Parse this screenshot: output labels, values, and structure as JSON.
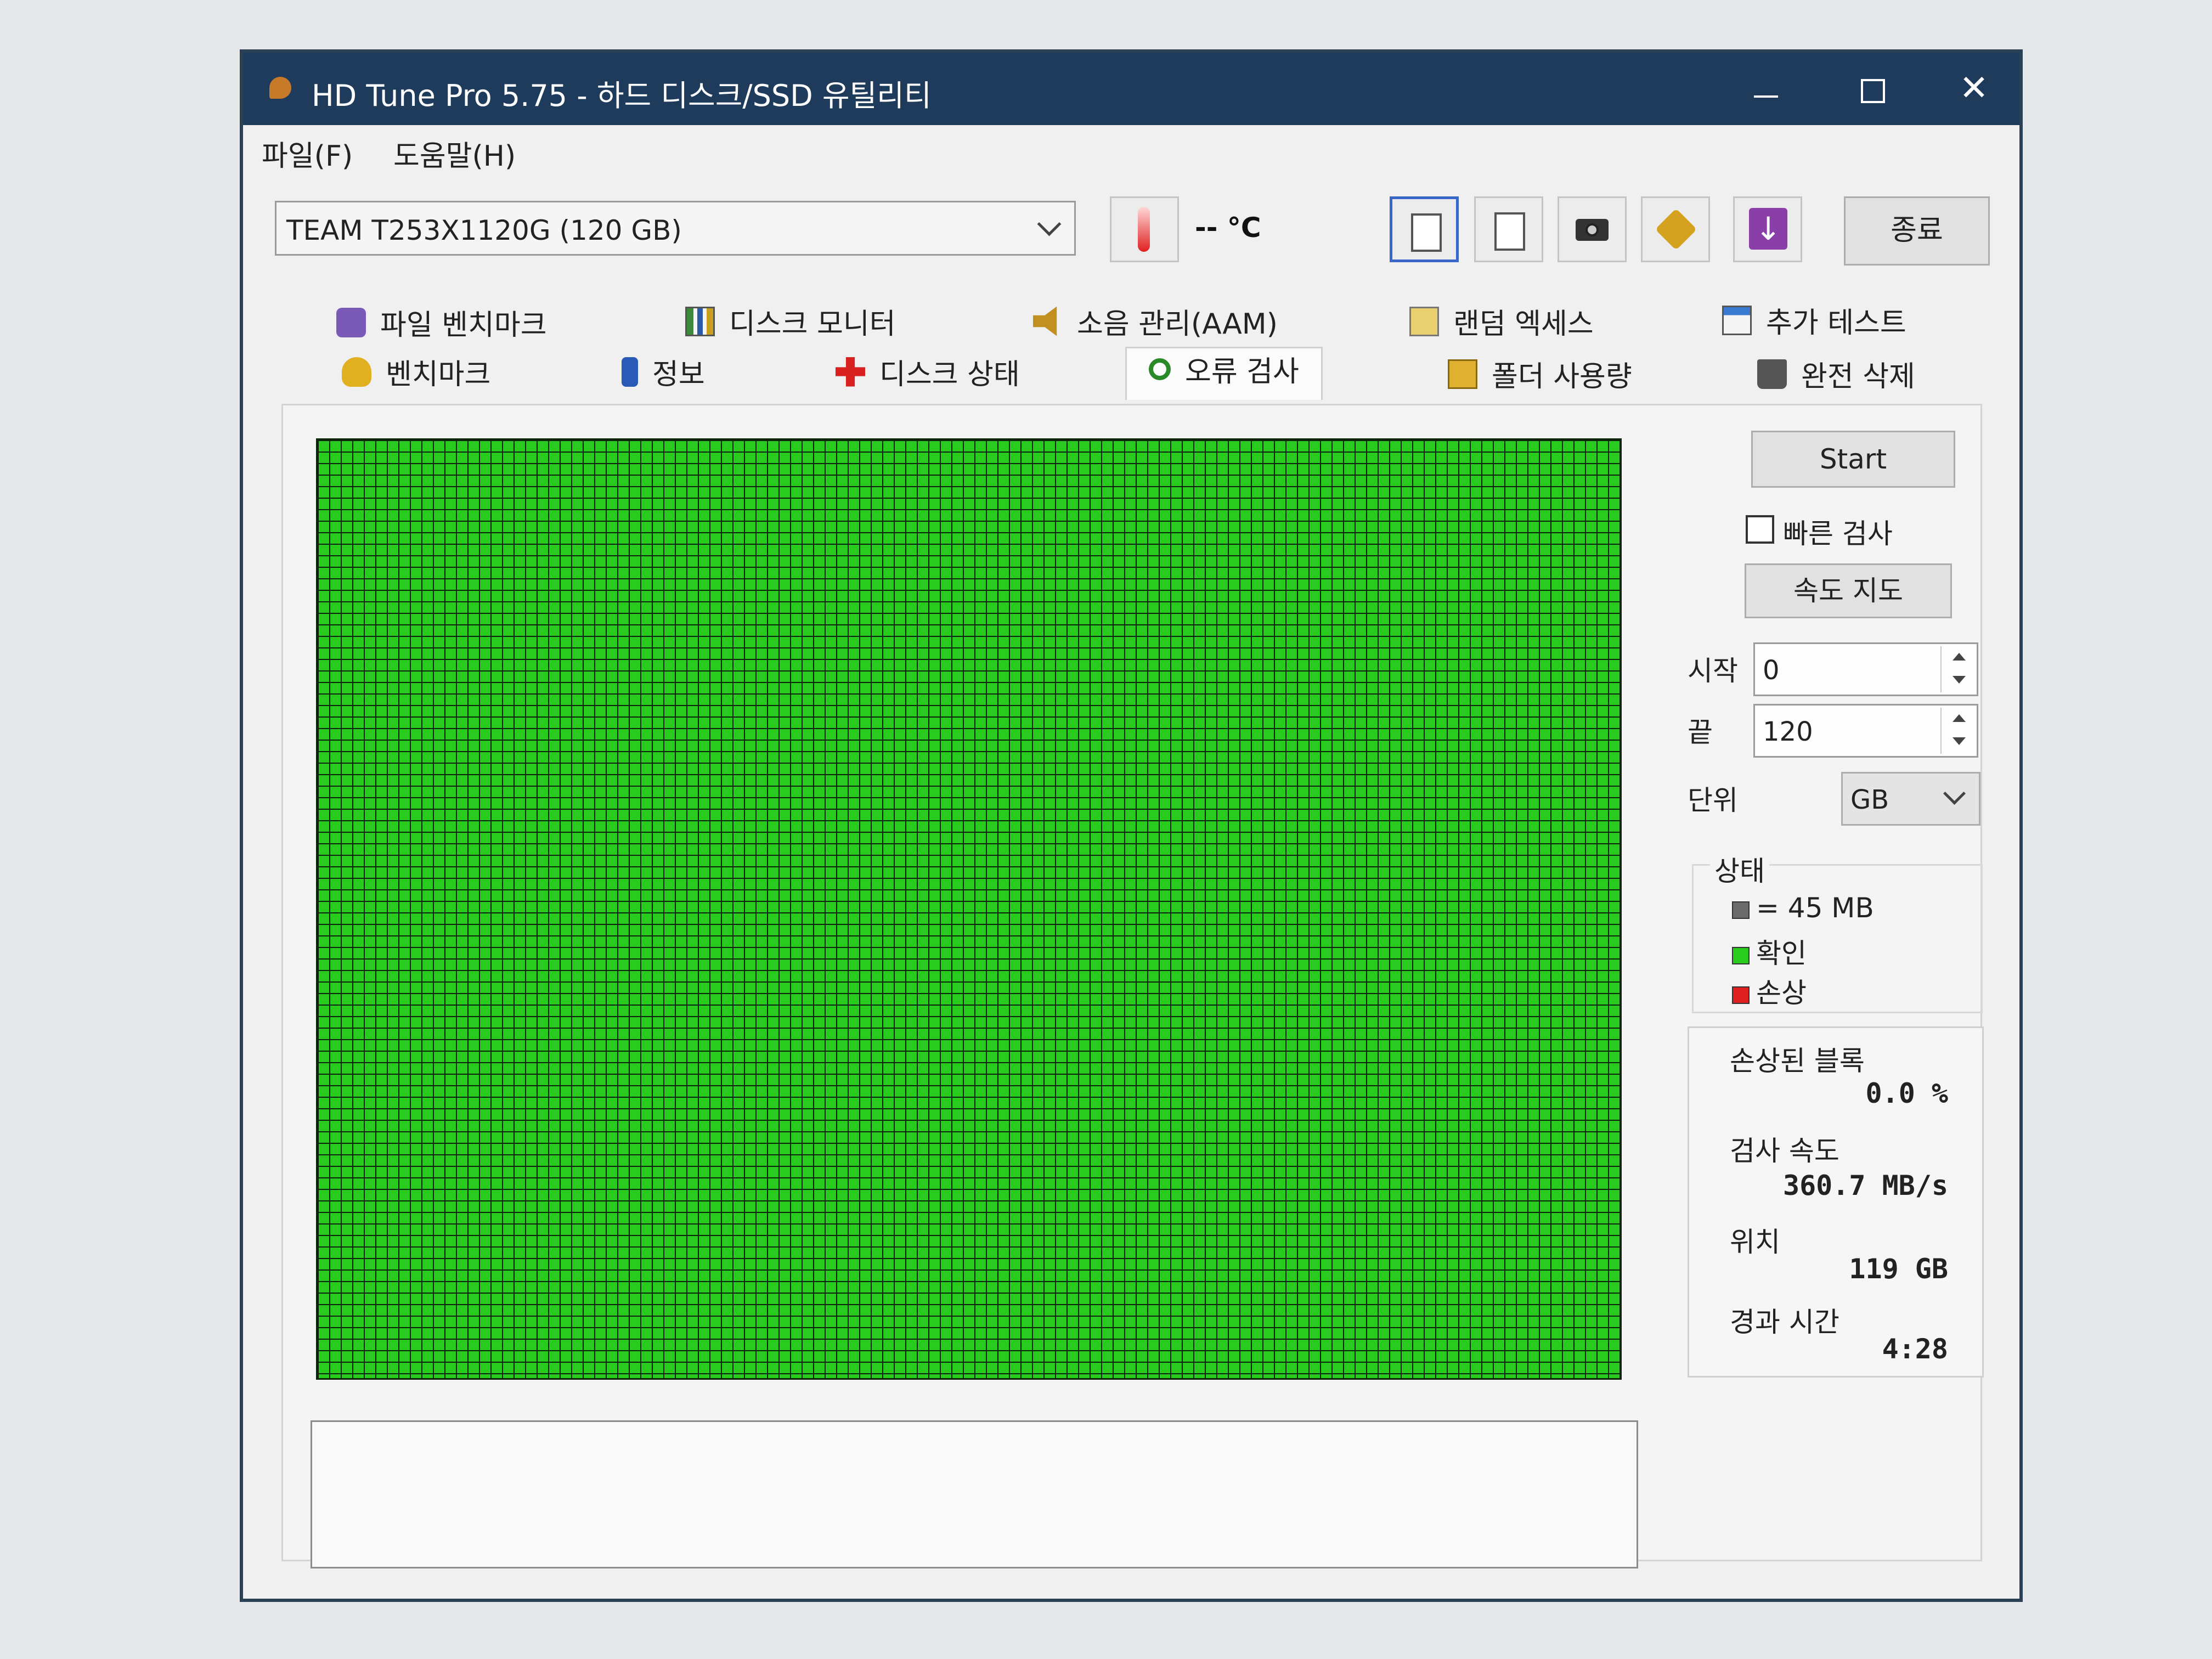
{
  "window": {
    "title": "HD Tune Pro 5.75 - 하드 디스크/SSD 유틸리티"
  },
  "menu": {
    "file": "파일(F)",
    "help": "도움말(H)"
  },
  "toolbar": {
    "drive": "TEAM T253X1120G (120 GB)",
    "temperature": "-- °C",
    "exit_label": "종료"
  },
  "tabs": {
    "file_benchmark": "파일 벤치마크",
    "disk_monitor": "디스크 모니터",
    "aam": "소음 관리(AAM)",
    "random_access": "랜덤 엑세스",
    "extra_tests": "추가 테스트",
    "benchmark": "벤치마크",
    "info": "정보",
    "health": "디스크 상태",
    "error_scan": "오류 검사",
    "folder_usage": "폴더 사용량",
    "erase": "완전 삭제"
  },
  "scan": {
    "start_label": "Start",
    "quick_scan_label": "빠른 검사",
    "quick_scan_checked": false,
    "speed_map_label": "속도 지도",
    "start_field_label": "시작",
    "start_value": "0",
    "end_field_label": "끝",
    "end_value": "120",
    "unit_label": "단위",
    "unit_value": "GB"
  },
  "status": {
    "title": "상태",
    "block_size": "= 45 MB",
    "ok_label": "확인",
    "damaged_label": "손상"
  },
  "stats": {
    "damaged_blocks_label": "손상된 블록",
    "damaged_blocks_value": "0.0 %",
    "scan_speed_label": "검사 속도",
    "scan_speed_value": "360.7 MB/s",
    "position_label": "위치",
    "position_value": "119 GB",
    "elapsed_label": "경과 시간",
    "elapsed_value": "4:28"
  },
  "colors": {
    "block_ok": "#29cc1e",
    "block_unscanned": "#6b6b6b",
    "block_damaged": "#e02020",
    "grid_line": "#0c250a"
  }
}
